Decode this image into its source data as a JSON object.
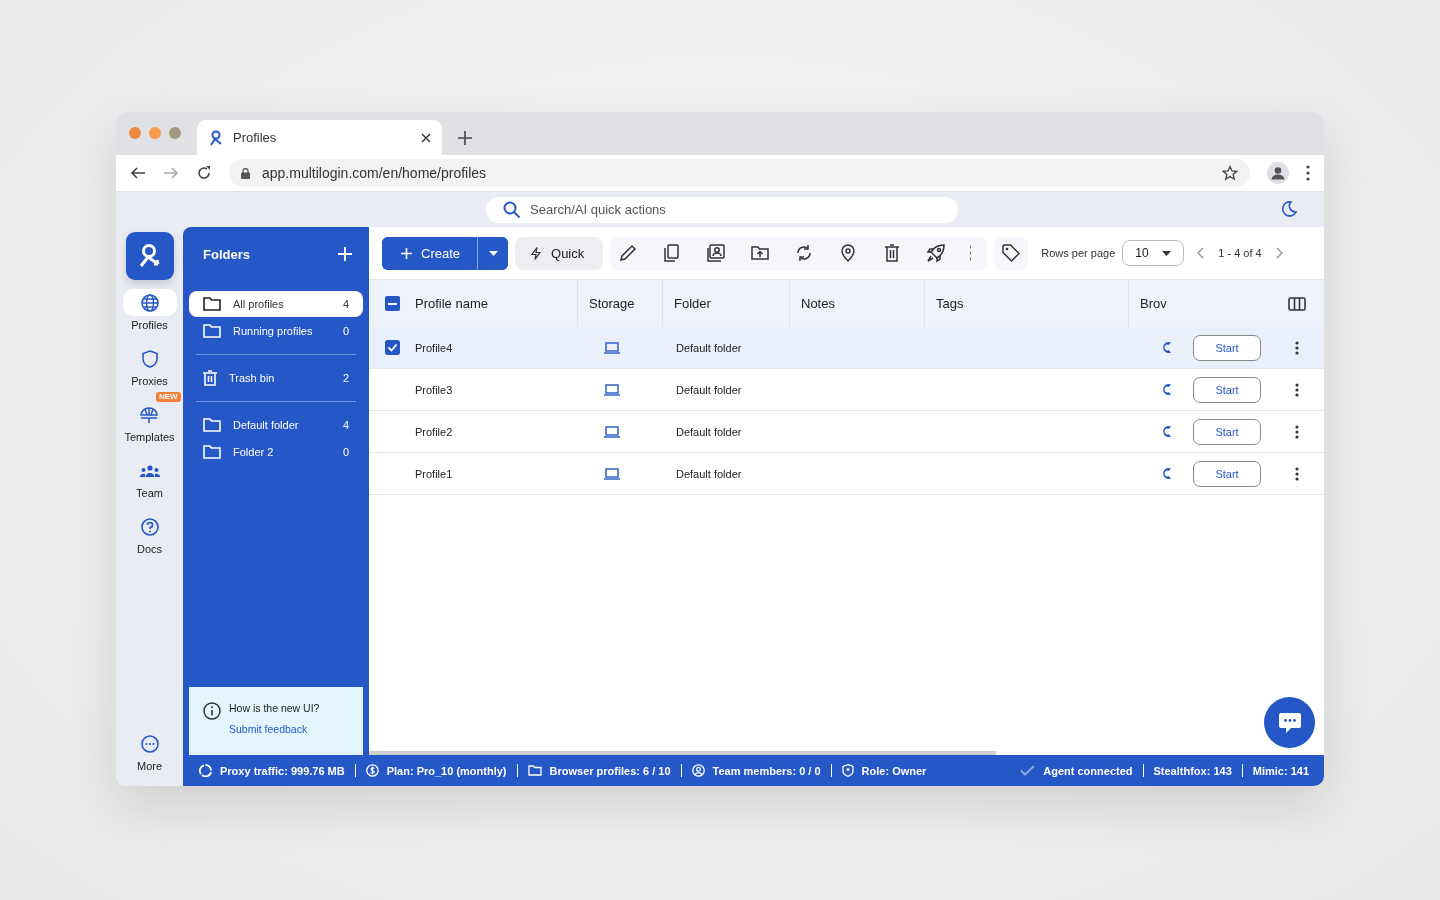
{
  "browser": {
    "tabs": [
      {
        "title": "Profiles",
        "selected": true
      }
    ],
    "url": "app.multilogin.com/en/home/profiles"
  },
  "search": {
    "placeholder": "Search/AI quick actions"
  },
  "rail": {
    "items": [
      {
        "label": "Profiles",
        "selected": true
      },
      {
        "label": "Proxies",
        "selected": false
      },
      {
        "label": "Templates",
        "selected": false,
        "badge": "NEW"
      },
      {
        "label": "Team",
        "selected": false
      },
      {
        "label": "Docs",
        "selected": false
      }
    ],
    "more": "More"
  },
  "folders": {
    "title": "Folders",
    "groups": [
      [
        {
          "name": "All profiles",
          "count": "4",
          "selected": true,
          "kind": "folder"
        },
        {
          "name": "Running profiles",
          "count": "0",
          "selected": false,
          "kind": "folder"
        }
      ],
      [
        {
          "name": "Trash bin",
          "count": "2",
          "selected": false,
          "kind": "trash"
        }
      ],
      [
        {
          "name": "Default folder",
          "count": "4",
          "selected": false,
          "kind": "folder"
        },
        {
          "name": "Folder 2",
          "count": "0",
          "selected": false,
          "kind": "folder"
        }
      ]
    ],
    "feedback": {
      "question": "How is the new UI?",
      "link": "Submit feedback"
    }
  },
  "toolbar": {
    "create": "Create",
    "quick": "Quick",
    "rows_per_page_label": "Rows per page",
    "rows_per_page": "10",
    "range": "1 - 4 of 4"
  },
  "table": {
    "select_all": {
      "indeterminate": true
    },
    "columns": [
      "Profile name",
      "Storage",
      "Folder",
      "Notes",
      "Tags",
      "Brov"
    ],
    "rows": [
      {
        "name": "Profile4",
        "folder": "Default folder",
        "selected": true,
        "action": "Start"
      },
      {
        "name": "Profile3",
        "folder": "Default folder",
        "selected": false,
        "action": "Start"
      },
      {
        "name": "Profile2",
        "folder": "Default folder",
        "selected": false,
        "action": "Start"
      },
      {
        "name": "Profile1",
        "folder": "Default folder",
        "selected": false,
        "action": "Start"
      }
    ]
  },
  "status_bar": {
    "left": [
      "Proxy traffic: 999.76 MB",
      "Plan: Pro_10 (monthly)",
      "Browser profiles: 6 / 10",
      "Team members: 0 / 0",
      "Role: Owner"
    ],
    "right": [
      "Agent connected",
      "Stealthfox: 143",
      "Mimic: 141"
    ]
  }
}
